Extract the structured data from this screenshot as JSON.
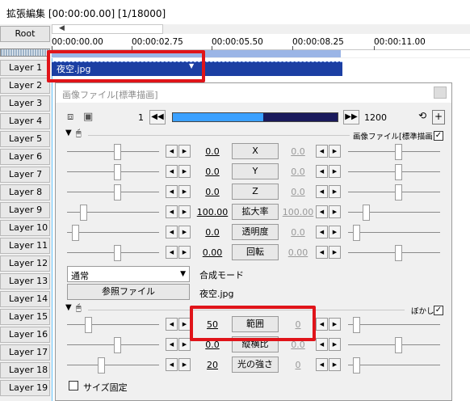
{
  "window": {
    "title": "拡張編集 [00:00:00.00] [1/18000]"
  },
  "timeline": {
    "root_label": "Root",
    "ticks": [
      "00:00:00.00",
      "00:00:02.75",
      "00:00:05.50",
      "00:00:08.25",
      "00:00:11.00"
    ],
    "layers": [
      "Layer 1",
      "Layer 2",
      "Layer 3",
      "Layer 4",
      "Layer 5",
      "Layer 6",
      "Layer 7",
      "Layer 8",
      "Layer 9",
      "Layer 10",
      "Layer 11",
      "Layer 12",
      "Layer 13",
      "Layer 14",
      "Layer 15",
      "Layer 16",
      "Layer 17",
      "Layer 18",
      "Layer 19"
    ],
    "clip_label": "夜空.jpg"
  },
  "panel": {
    "title": "画像ファイル[標準描画]",
    "frame_start": "1",
    "frame_end": "1200",
    "frame_position": 0.55,
    "section1_label": "画像ファイル[標準描画]",
    "params": [
      {
        "name": "X",
        "left": "0.0",
        "right": "0.0"
      },
      {
        "name": "Y",
        "left": "0.0",
        "right": "0.0"
      },
      {
        "name": "Z",
        "left": "0.0",
        "right": "0.0"
      },
      {
        "name": "拡大率",
        "left": "100.00",
        "right": "100.00"
      },
      {
        "name": "透明度",
        "left": "0.0",
        "right": "0.0"
      },
      {
        "name": "回転",
        "left": "0.00",
        "right": "0.00"
      }
    ],
    "blend_mode": "通常",
    "blend_label": "合成モード",
    "ref_button": "参照ファイル",
    "file_name": "夜空.jpg",
    "section2_label": "ぼかし",
    "blur_params": [
      {
        "name": "範囲",
        "left": "50",
        "right": "0"
      },
      {
        "name": "縦横比",
        "left": "0.0",
        "right": "0.0"
      },
      {
        "name": "光の強さ",
        "left": "20",
        "right": "0"
      }
    ],
    "fix_size_label": "サイズ固定"
  },
  "accent": {
    "highlight": "#e0141a",
    "clip": "#1c3fa3",
    "selection": "#9bb5e6"
  }
}
